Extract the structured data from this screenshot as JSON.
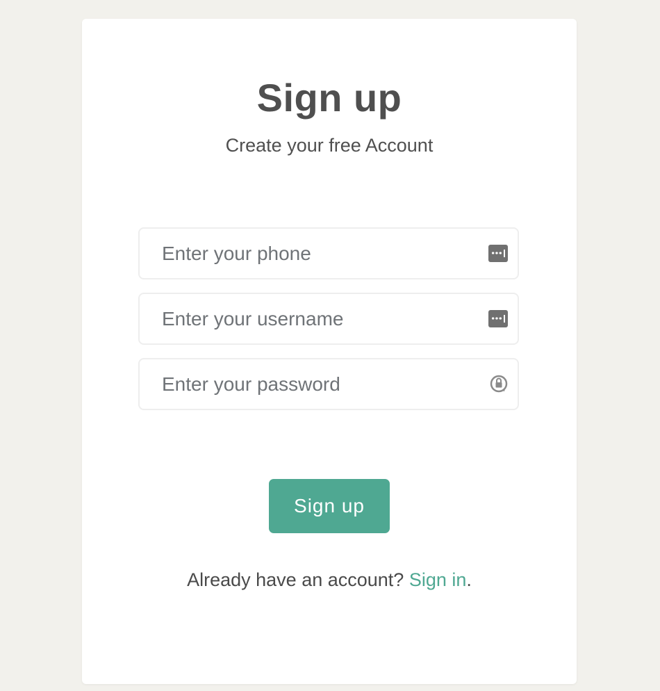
{
  "colors": {
    "page_background": "#f2f1ec",
    "card_background": "#ffffff",
    "accent": "#4fa892",
    "text": "#4f4f4f",
    "placeholder": "#6f7377",
    "icon": "#707070"
  },
  "header": {
    "title": "Sign up",
    "subtitle": "Create your free Account"
  },
  "form": {
    "phone": {
      "placeholder": "Enter your phone",
      "value": "",
      "icon": "password-manager-key-icon"
    },
    "username": {
      "placeholder": "Enter your username",
      "value": "",
      "icon": "password-manager-key-icon"
    },
    "password": {
      "placeholder": "Enter your password",
      "value": "",
      "icon": "password-lock-icon"
    },
    "submit_label": "Sign up"
  },
  "footer": {
    "prompt": "Already have an account? ",
    "link_label": "Sign in",
    "suffix": "."
  }
}
